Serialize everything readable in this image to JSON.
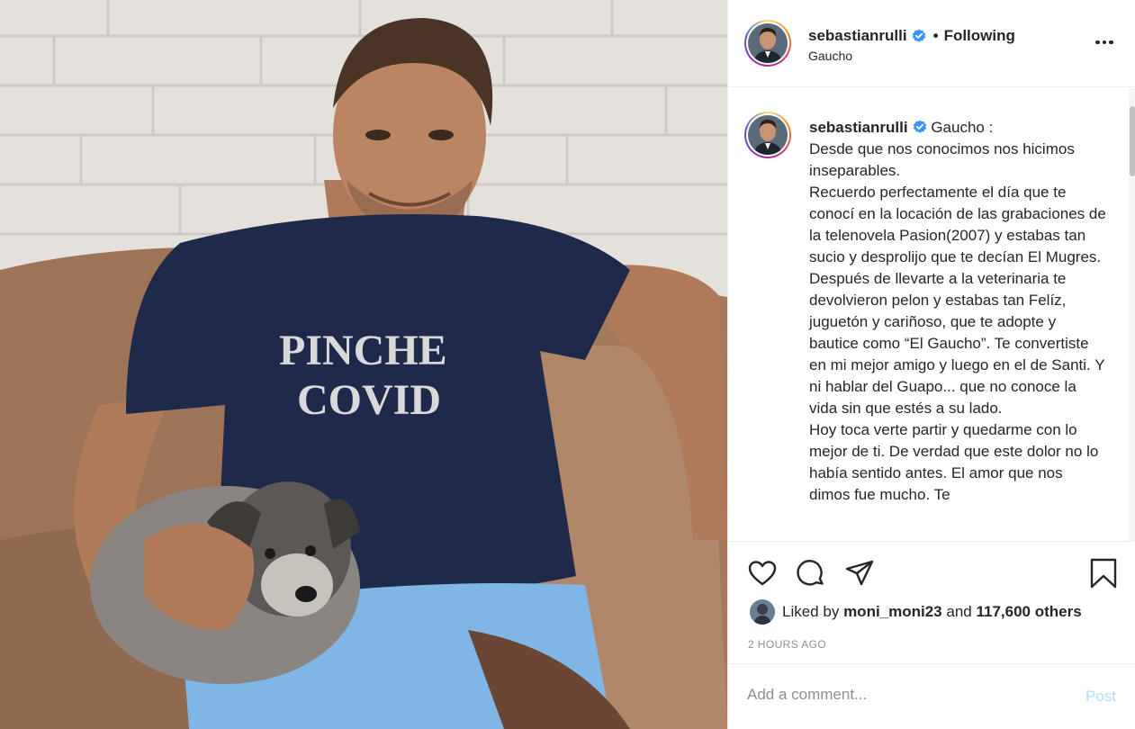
{
  "post": {
    "username": "sebastianrulli",
    "follow_status": "Following",
    "separator": "•",
    "location": "Gaucho",
    "caption_text": " Gaucho :\nDesde que nos conocimos nos hicimos inseparables.\nRecuerdo perfectamente el día que te conocí en la locación de las grabaciones de la telenovela Pasion(2007) y estabas tan sucio y desprolijo que te decían El Mugres.\nDespués de llevarte a la veterinaria te devolvieron pelon y estabas tan Felíz, juguetón y cariñoso, que te adopte y bautice como “El Gaucho”. Te convertiste en mi mejor amigo y luego en el de Santi. Y ni hablar del Guapo... que no conoce la vida sin que estés a su lado.\nHoy toca verte partir y quedarme con lo mejor de ti. De verdad que este dolor no lo había sentido antes. El amor que nos dimos fue mucho. Te",
    "shirt_text_line1": "PINCHE",
    "shirt_text_line2": "COVID"
  },
  "likes": {
    "prefix": "Liked by",
    "user": "moni_moni23",
    "conjunction": "and",
    "count": "117,600 others"
  },
  "timestamp": "2 HOURS AGO",
  "comment": {
    "placeholder": "Add a comment...",
    "post_label": "Post"
  },
  "icons": {
    "more": "more-options-icon",
    "like": "heart-icon",
    "comment": "comment-icon",
    "share": "share-icon",
    "save": "bookmark-icon",
    "verified": "verified-badge-icon"
  },
  "colors": {
    "text": "#262626",
    "muted": "#8e8e8e",
    "verified": "#3897f0",
    "post_disabled": "#b2dffc"
  }
}
